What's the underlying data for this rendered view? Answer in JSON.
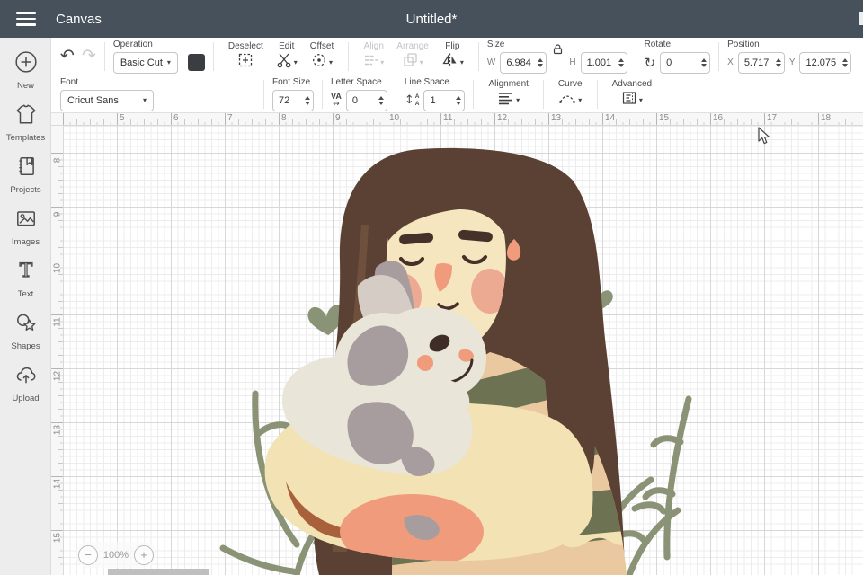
{
  "titlebar": {
    "app_title": "Canvas",
    "doc_title": "Untitled*"
  },
  "edit_toolbar": {
    "operation_label": "Operation",
    "operation_value": "Basic Cut",
    "deselect_label": "Deselect",
    "edit_label": "Edit",
    "offset_label": "Offset",
    "align_label": "Align",
    "arrange_label": "Arrange",
    "flip_label": "Flip",
    "size_label": "Size",
    "w_label": "W",
    "w_value": "6.984",
    "h_label": "H",
    "h_value": "1.001",
    "rotate_label": "Rotate",
    "rotate_value": "0",
    "position_label": "Position",
    "x_label": "X",
    "x_value": "5.717",
    "y_label": "Y",
    "y_value": "12.075"
  },
  "text_toolbar": {
    "font_label": "Font",
    "font_value": "Cricut Sans",
    "font_size_label": "Font Size",
    "font_size_value": "72",
    "letter_space_label": "Letter Space",
    "letter_space_value": "0",
    "letter_space_glyph": "VA",
    "line_space_label": "Line Space",
    "line_space_value": "1",
    "alignment_label": "Alignment",
    "curve_label": "Curve",
    "advanced_label": "Advanced"
  },
  "sidebar": {
    "items": [
      {
        "label": "New"
      },
      {
        "label": "Templates"
      },
      {
        "label": "Projects"
      },
      {
        "label": "Images"
      },
      {
        "label": "Text"
      },
      {
        "label": "Shapes"
      },
      {
        "label": "Upload"
      }
    ]
  },
  "canvas": {
    "h_ruler_numbers": [
      5,
      6,
      7,
      8,
      9,
      10,
      11,
      12,
      13,
      14,
      15,
      16,
      17,
      18
    ],
    "v_ruler_numbers": [
      8,
      9,
      10,
      11,
      12,
      13,
      14,
      15
    ],
    "zoom_value": "100%",
    "artwork_description": "illustration of woman with long brown hair holding a white rabbit, with sage hearts and leaves"
  },
  "colors": {
    "topbar": "#46515b",
    "art": {
      "hair": "#5a4133",
      "hairlight": "#6f503c",
      "skin": "#f5e6bf",
      "arm": "#f3e2b4",
      "coral": "#ef9b7c",
      "blush": "#edaa92",
      "rabbit": "#eae5d9",
      "rabbitgray": "#a89d9e",
      "rabbitshadow": "#d6ccc6",
      "olive": "#6d7252",
      "tan": "#ebc9a0",
      "sage": "#8a9376",
      "rust": "#a9613c",
      "line": "#46302a"
    }
  }
}
